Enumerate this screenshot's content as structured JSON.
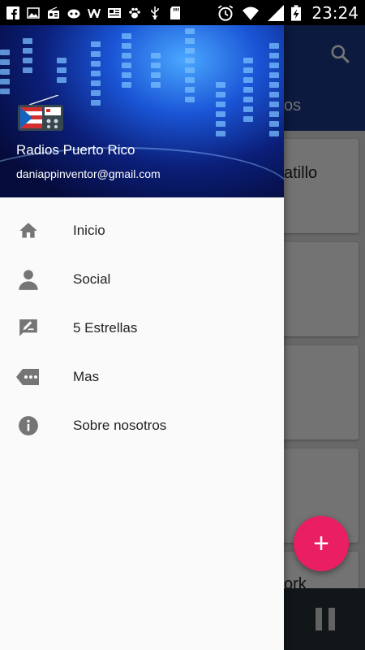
{
  "status_bar": {
    "time": "23:24",
    "icons_left": [
      "facebook-icon",
      "image-icon",
      "radio-icon",
      "gamepad-icon",
      "w-app-icon",
      "news-icon",
      "paw-icon",
      "usb-icon",
      "sd-card-icon"
    ],
    "icons_right": [
      "alarm-icon",
      "wifi-icon",
      "signal-icon",
      "battery-charging-icon"
    ]
  },
  "drawer": {
    "header": {
      "title": "Radios Puerto Rico",
      "email": "daniappinventor@gmail.com"
    },
    "items": [
      {
        "label": "Inicio",
        "icon": "home-icon"
      },
      {
        "label": "Social",
        "icon": "person-icon"
      },
      {
        "label": "5 Estrellas",
        "icon": "rate-review-icon"
      },
      {
        "label": "Mas",
        "icon": "more-label-icon"
      },
      {
        "label": "Sobre nosotros",
        "icon": "info-icon"
      }
    ]
  },
  "background_app": {
    "tab_fragment": "os",
    "card_fragments": [
      "atillo",
      "ork"
    ],
    "fab_label": "+",
    "colors": {
      "appbar": "#1a3a8a",
      "fab": "#e91e63",
      "player": "#263238"
    }
  }
}
